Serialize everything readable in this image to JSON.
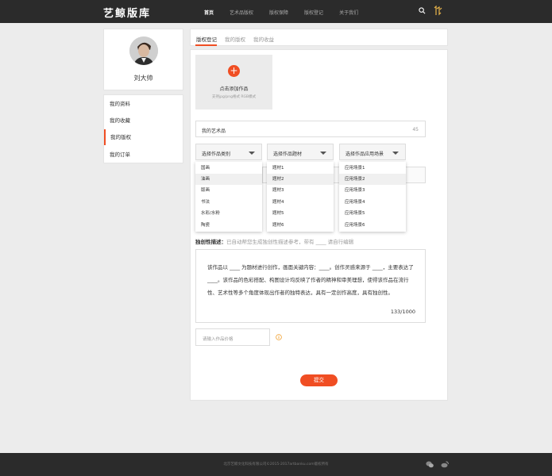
{
  "header": {
    "logo": "艺鲸版库",
    "nav": [
      "首页",
      "艺术品版权",
      "版权保障",
      "版权登记",
      "关于我们"
    ],
    "icons": {
      "search": "search-icon",
      "brand": "brand-mark-icon"
    }
  },
  "profile": {
    "name": "刘大帅"
  },
  "sidebar": {
    "items": [
      "我的资料",
      "我的收藏",
      "我的版权",
      "我的订单"
    ],
    "active_index": 2
  },
  "tabs": [
    "版权登记",
    "我的版权",
    "我的收益"
  ],
  "upload": {
    "title": "点击添加作品",
    "sub": "支持jpg/png格式 RGB模式"
  },
  "title_field": {
    "value": "我的艺术品",
    "count": "45"
  },
  "selects": [
    {
      "label": "选择作品类别",
      "options": [
        "国画",
        "油画",
        "版画",
        "书法",
        "水彩/水粉",
        "陶瓷"
      ],
      "highlighted": 1
    },
    {
      "label": "选择作品题材",
      "options": [
        "题材1",
        "题材2",
        "题材3",
        "题材4",
        "题材5",
        "题材6"
      ],
      "highlighted": 1
    },
    {
      "label": "选择作品应用场景",
      "options": [
        "应用场景1",
        "应用场景2",
        "应用场景3",
        "应用场景4",
        "应用场景5",
        "应用场景6"
      ],
      "highlighted": 1
    }
  ],
  "description": {
    "label": "独创性描述：",
    "hint": "已自动帮您生成独创性描述参考，带有 ____ 请自行编辑",
    "text": "该作品以 ____ 为题材进行创作，画面关键内容：____。创作灵感来源于 ____，主要表达了 ____。该作品的色彩搭配、构图设计均反映了作者的精神和审美理想，使得该作品在流行性、艺术性等多个角度体现出作者的独特表达，具有一定创作高度，具有独创性。",
    "count": "133/1000"
  },
  "price": {
    "placeholder": "请输入作品价格"
  },
  "submit_label": "提交",
  "footer": {
    "copyright": "北京艺鲸文化科技有限公司©2015-2017artbanku.com版权所有"
  },
  "colors": {
    "accent": "#f04e23",
    "header_bg": "#2b2b2b",
    "page_bg": "#ececec"
  }
}
